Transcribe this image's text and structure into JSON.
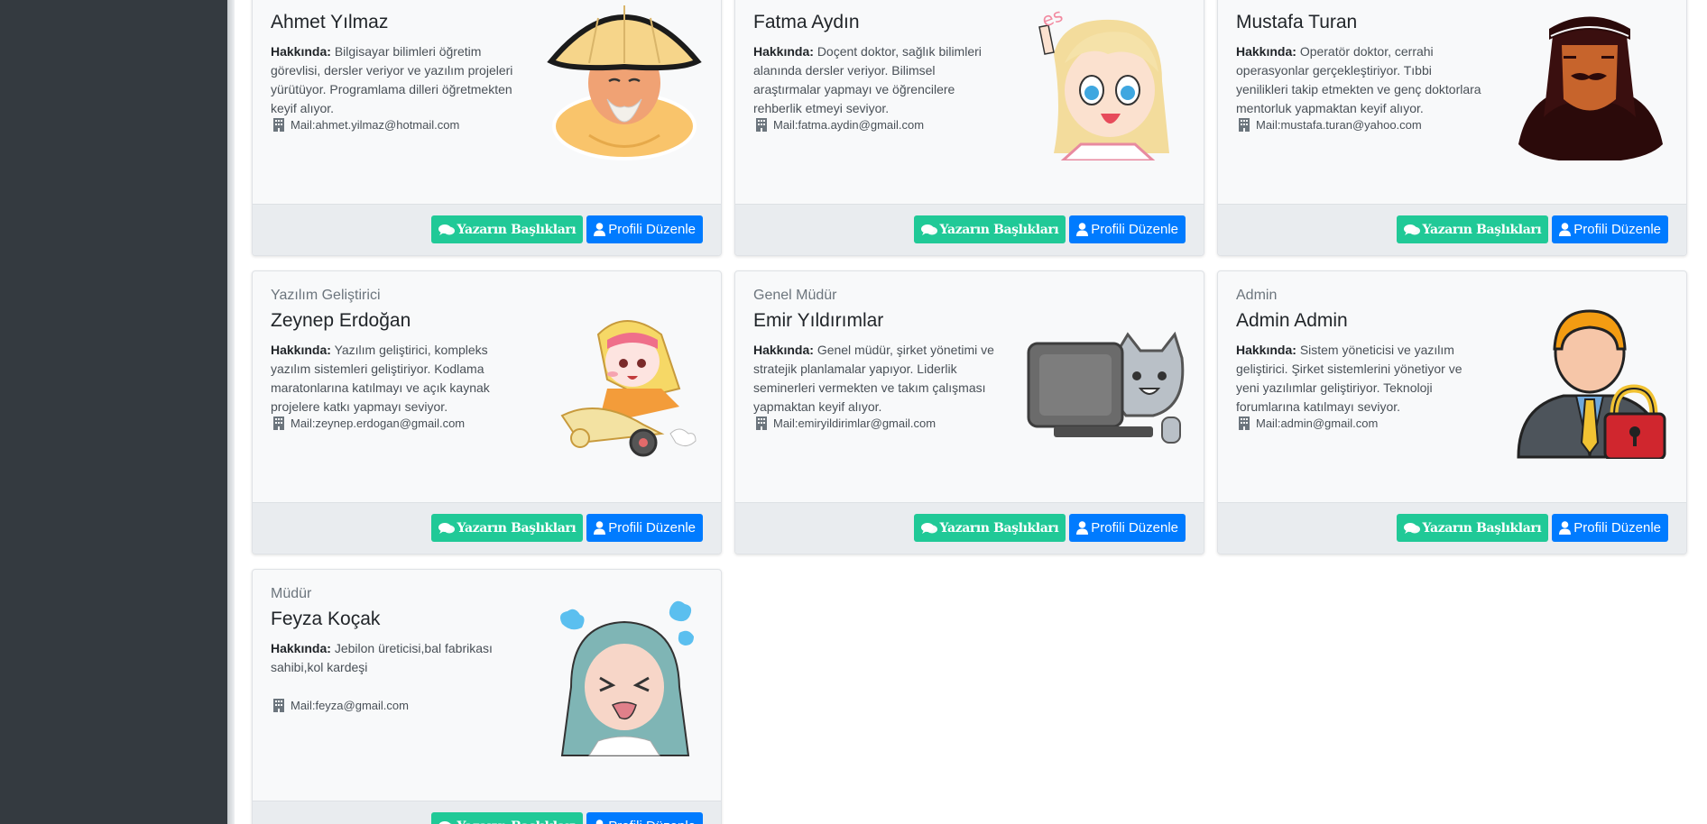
{
  "buttons": {
    "titles_label": "Yazarın Başlıkları",
    "edit_label": "Profili Düzenle"
  },
  "about_label": "Hakkında:",
  "mail_prefix": "Mail:",
  "cards": [
    {
      "role": "",
      "name": "Ahmet Yılmaz",
      "about": "Bilgisayar bilimleri öğretim görevlisi, dersler veriyor ve yazılım projeleri yürütüyor. Programlama dilleri öğretmekten keyif alıyor.",
      "mail": "ahmet.yilmaz@hotmail.com",
      "avatar": "straw-hat-elder-avatar"
    },
    {
      "role": "",
      "name": "Fatma Aydın",
      "about": "Doçent doktor, sağlık bilimleri alanında dersler veriyor. Bilimsel araştırmalar yapmayı ve öğrencilere rehberlik etmeyi seviyor.",
      "mail": "fatma.aydin@gmail.com",
      "avatar": "blonde-girl-avatar"
    },
    {
      "role": "",
      "name": "Mustafa Turan",
      "about": "Operatör doktor, cerrahi operasyonlar gerçekleştiriyor. Tıbbi yenilikleri takip etmekten ve genç doktorlara mentorluk yapmaktan keyif alıyor.",
      "mail": "mustafa.turan@yahoo.com",
      "avatar": "keffiyeh-man-avatar"
    },
    {
      "role": "Yazılım Geliştirici",
      "name": "Zeynep Erdoğan",
      "about": "Yazılım geliştirici, kompleks yazılım sistemleri geliştiriyor. Kodlama maratonlarına katılmayı ve açık kaynak projelere katkı yapmayı seviyor.",
      "mail": "zeynep.erdogan@gmail.com",
      "avatar": "scooter-girl-avatar"
    },
    {
      "role": "Genel Müdür",
      "name": "Emir Yıldırımlar",
      "about": "Genel müdür, şirket yönetimi ve stratejik planlamalar yapıyor. Liderlik seminerleri vermekten ve takım çalışması yapmaktan keyif alıyor.",
      "mail": "emiryildirimlar@gmail.com",
      "avatar": "cat-computer-avatar"
    },
    {
      "role": "Admin",
      "name": "Admin Admin",
      "about": "Sistem yöneticisi ve yazılım geliştirici. Şirket sistemlerini yönetiyor ve yeni yazılımlar geliştiriyor. Teknoloji forumlarına katılmayı seviyor.",
      "mail": "admin@gmail.com",
      "avatar": "admin-lock-avatar"
    },
    {
      "role": "Müdür",
      "name": "Feyza Koçak",
      "about": "Jebilon üreticisi,bal fabrikası sahibi,kol kardeşi",
      "mail": "feyza@gmail.com",
      "avatar": "hijab-girl-avatar"
    }
  ],
  "colors": {
    "sidebar": "#343a40",
    "green": "#20c997",
    "blue": "#007bff",
    "card_bg": "#f8f9fa",
    "footer_bg": "#e9ecef"
  }
}
